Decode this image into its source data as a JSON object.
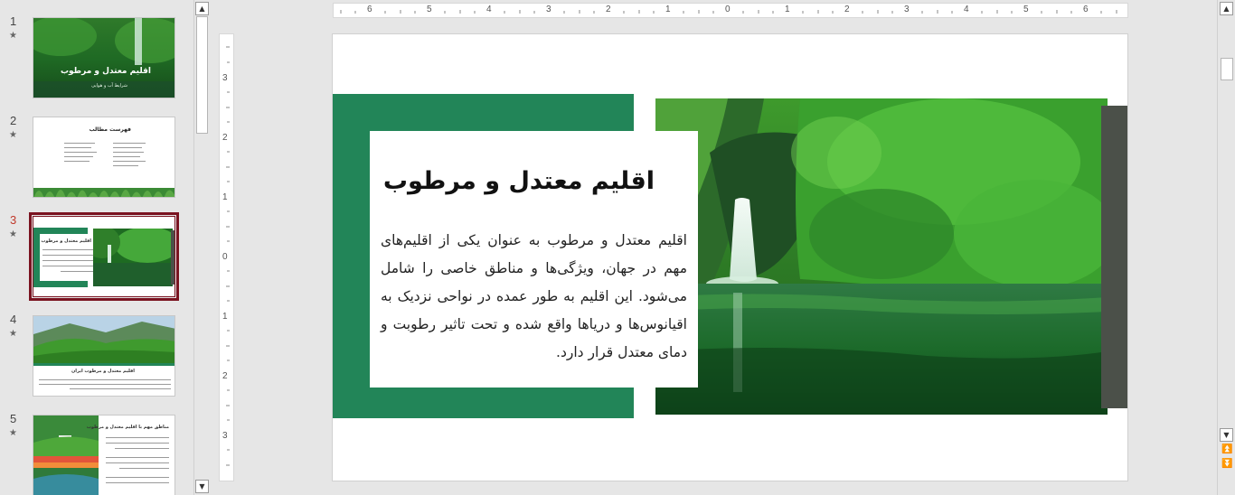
{
  "thumbnails": [
    {
      "number": "1",
      "star": "★",
      "title": "اقلیم معتدل و مرطوب",
      "subtitle": "شرایط آب و هوایی"
    },
    {
      "number": "2",
      "star": "★",
      "title": "فهرست مطالب"
    },
    {
      "number": "3",
      "star": "★",
      "title": "اقلیم معتدل و مرطوب",
      "selected": true
    },
    {
      "number": "4",
      "star": "★",
      "title": "اقلیم معتدل و مرطوب ایران"
    },
    {
      "number": "5",
      "star": "★",
      "title": "مناطق مهم با اقلیم معتدل و مرطوب"
    }
  ],
  "ruler": {
    "horizontal": [
      "6",
      "5",
      "4",
      "3",
      "2",
      "1",
      "0",
      "1",
      "2",
      "3",
      "4",
      "5",
      "6"
    ],
    "vertical": [
      "3",
      "2",
      "1",
      "0",
      "1",
      "2",
      "3"
    ]
  },
  "slide": {
    "title": "اقلیم معتدل و مرطوب",
    "body": "اقلیم معتدل و مرطوب به عنوان یکی از اقلیم‌های مهم در جهان، ویژگی‌ها و مناطق خاصی را شامل می‌شود. این اقلیم به طور عمده در نواحی نزدیک به اقیانوس‌ها و دریاها واقع شده و تحت تاثیر رطوبت و دمای معتدل قرار دارد.",
    "image": "waterfall-forest-photo"
  },
  "icons": {
    "scroll_up": "scroll-up-arrow-icon",
    "scroll_down": "scroll-down-arrow-icon",
    "prev_slide": "previous-slide-icon",
    "next_slide": "next-slide-icon"
  },
  "colors": {
    "green_block": "#228558",
    "dark_bar": "#4b5049",
    "selection": "#7a1320",
    "active_number": "#c0392b"
  }
}
